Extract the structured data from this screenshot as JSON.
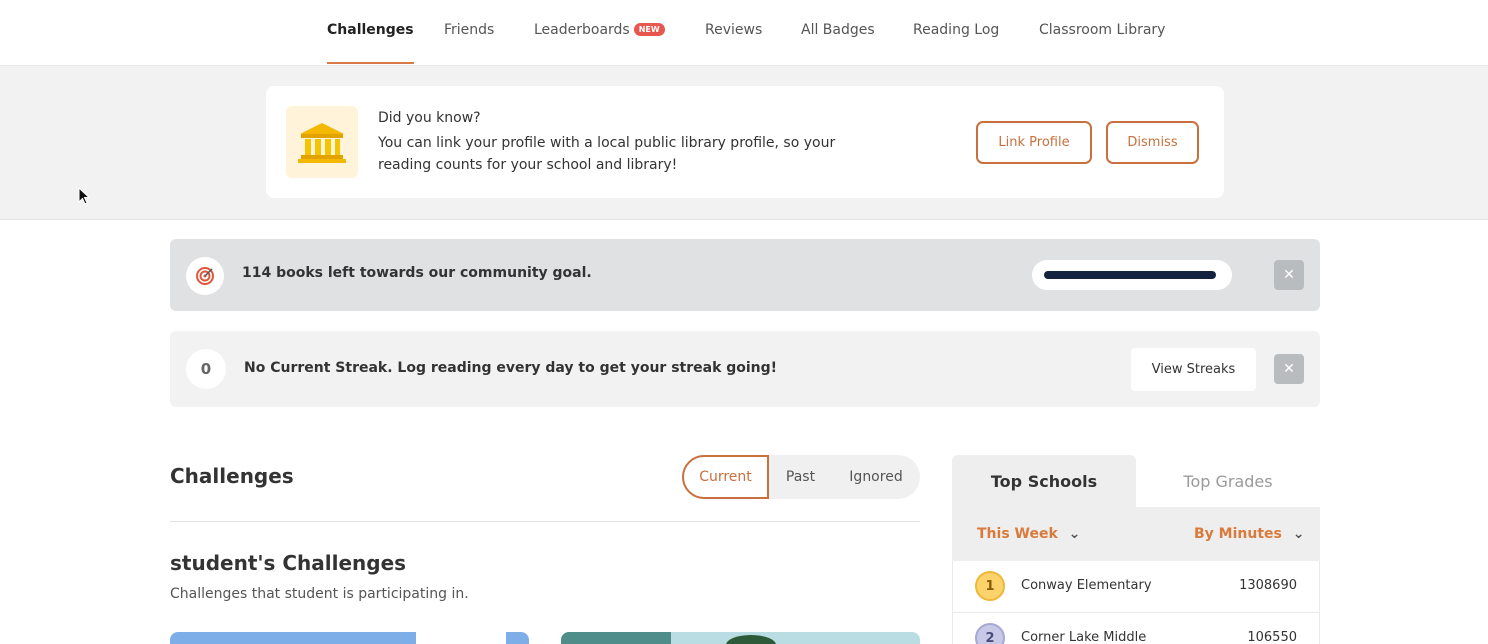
{
  "nav": {
    "items": [
      {
        "label": "Challenges",
        "active": true
      },
      {
        "label": "Friends"
      },
      {
        "label": "Leaderboards",
        "badge": "NEW"
      },
      {
        "label": "Reviews"
      },
      {
        "label": "All Badges"
      },
      {
        "label": "Reading Log"
      },
      {
        "label": "Classroom Library"
      }
    ]
  },
  "banner": {
    "icon": "library-building-icon",
    "title": "Did you know?",
    "text": "You can link your profile with a local public library profile, so your reading counts for your school and library!",
    "link_label": "Link Profile",
    "dismiss_label": "Dismiss"
  },
  "goal": {
    "icon": "target-icon",
    "text": "114 books left towards our community goal.",
    "progress": 0.98
  },
  "streak": {
    "count": "0",
    "text": "No Current Streak. Log reading every day to get your streak going!",
    "button_label": "View Streaks"
  },
  "challenges": {
    "title": "Challenges",
    "filters": [
      "Current",
      "Past",
      "Ignored"
    ],
    "active_filter": "Current",
    "section_title": "student's Challenges",
    "section_subtitle": "Challenges that student is participating in."
  },
  "leaderboard": {
    "tabs": [
      "Top Schools",
      "Top Grades"
    ],
    "active_tab": "Top Schools",
    "period": "This Week",
    "metric": "By Minutes",
    "rows": [
      {
        "rank": "1",
        "name": "Conway Elementary",
        "score": "1308690"
      },
      {
        "rank": "2",
        "name": "Corner Lake Middle",
        "score": "106550"
      }
    ]
  },
  "colors": {
    "accent": "#c8703e",
    "progress": "#13233f",
    "badge": "#e8574f"
  }
}
